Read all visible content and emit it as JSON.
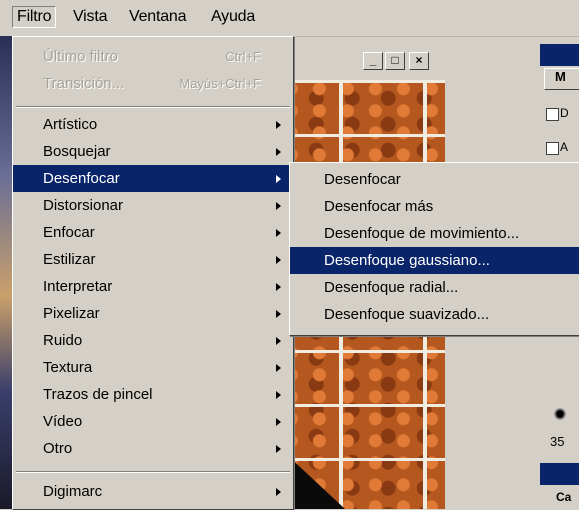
{
  "menubar": {
    "items": [
      {
        "label": "Filtro",
        "active": true
      },
      {
        "label": "Vista"
      },
      {
        "label": "Ventana"
      },
      {
        "label": "Ayuda"
      }
    ]
  },
  "filter_menu": {
    "disabled_items": [
      {
        "label": "Último filtro",
        "shortcut": "Ctrl+F"
      },
      {
        "label": "Transición...",
        "shortcut": "Mayús+Ctrl+F"
      }
    ],
    "items": [
      {
        "label": "Artístico"
      },
      {
        "label": "Bosquejar"
      },
      {
        "label": "Desenfocar",
        "highlighted": true
      },
      {
        "label": "Distorsionar"
      },
      {
        "label": "Enfocar"
      },
      {
        "label": "Estilizar"
      },
      {
        "label": "Interpretar"
      },
      {
        "label": "Pixelizar"
      },
      {
        "label": "Ruido"
      },
      {
        "label": "Textura"
      },
      {
        "label": "Trazos de pincel"
      },
      {
        "label": "Vídeo"
      },
      {
        "label": "Otro"
      }
    ],
    "bottom_item": {
      "label": "Digimarc"
    }
  },
  "blur_submenu": {
    "items": [
      {
        "label": "Desenfocar"
      },
      {
        "label": "Desenfocar más"
      },
      {
        "label": "Desenfoque de movimiento..."
      },
      {
        "label": "Desenfoque gaussiano...",
        "highlighted": true
      },
      {
        "label": "Desenfoque radial..."
      },
      {
        "label": "Desenfoque suavizado..."
      }
    ]
  },
  "document_window": {
    "buttons": {
      "minimize": "_",
      "maximize": "□",
      "close": "×"
    }
  },
  "right_panel": {
    "button_label": "M",
    "check1_label": "D",
    "check2_label": "A",
    "brush_size": "35",
    "bottom_label": "Ca"
  },
  "colors": {
    "highlight": "#0a246a",
    "menu_bg": "#d4d0c8",
    "disabled": "#a6a39c"
  }
}
